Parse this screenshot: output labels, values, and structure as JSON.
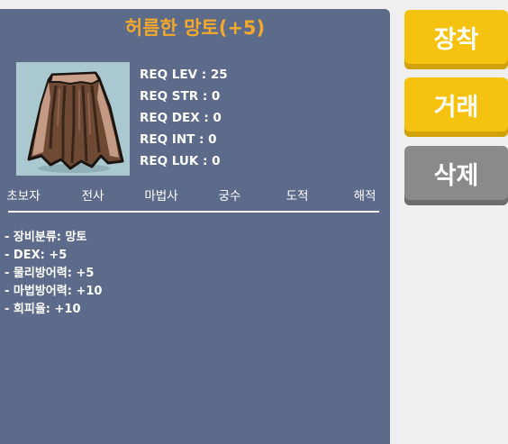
{
  "item": {
    "name": "허름한 망토(+5)",
    "name_color": "#f4a82c",
    "icon": "tattered-brown-cape-icon"
  },
  "requirements": [
    "REQ LEV : 25",
    "REQ STR : 0",
    "REQ DEX : 0",
    "REQ INT : 0",
    "REQ LUK : 0"
  ],
  "jobs": [
    "초보자",
    "전사",
    "마법사",
    "궁수",
    "도적",
    "해적"
  ],
  "stats": [
    "- 장비분류: 망토",
    "- DEX: +5",
    "- 물리방어력: +5",
    "- 마법방어력: +10",
    "- 회피율: +10"
  ],
  "actions": {
    "equip": "장착",
    "trade": "거래",
    "delete": "삭제"
  },
  "colors": {
    "panel": "#5c6b8a",
    "button_active": "#f4c20f",
    "button_active_shadow": "#d1a10a",
    "button_disabled": "#8a8a8a",
    "button_disabled_shadow": "#6d6d6d"
  }
}
